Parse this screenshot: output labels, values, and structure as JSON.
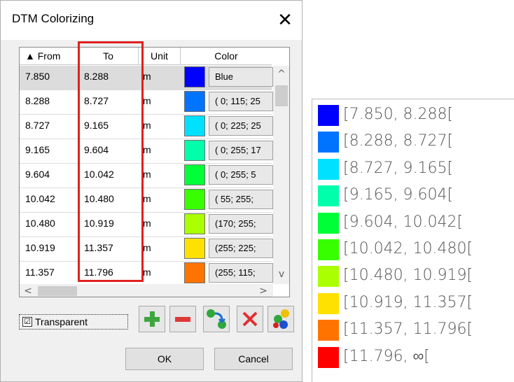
{
  "dialog": {
    "title": "DTM Colorizing",
    "close_glyph": "✕",
    "columns": {
      "from": "▲ From",
      "to": "To",
      "unit": "Unit",
      "color": "Color"
    },
    "rows": [
      {
        "from": "7.850",
        "to": "8.288",
        "unit": "m",
        "color": "#0000ff",
        "color_label": "Blue"
      },
      {
        "from": "8.288",
        "to": "8.727",
        "unit": "m",
        "color": "#0073ff",
        "color_label": "( 0; 115; 25"
      },
      {
        "from": "8.727",
        "to": "9.165",
        "unit": "m",
        "color": "#00e1ff",
        "color_label": "( 0; 225; 25"
      },
      {
        "from": "9.165",
        "to": "9.604",
        "unit": "m",
        "color": "#00ffaa",
        "color_label": "( 0; 255; 17"
      },
      {
        "from": "9.604",
        "to": "10.042",
        "unit": "m",
        "color": "#00ff37",
        "color_label": "( 0; 255;  5"
      },
      {
        "from": "10.042",
        "to": "10.480",
        "unit": "m",
        "color": "#37ff00",
        "color_label": "( 55; 255;"
      },
      {
        "from": "10.480",
        "to": "10.919",
        "unit": "m",
        "color": "#aaff00",
        "color_label": "(170; 255;"
      },
      {
        "from": "10.919",
        "to": "11.357",
        "unit": "m",
        "color": "#ffe100",
        "color_label": "(255; 225;"
      },
      {
        "from": "11.357",
        "to": "11.796",
        "unit": "m",
        "color": "#ff7300",
        "color_label": "(255; 115;"
      }
    ],
    "transparent_label": "Transparent",
    "transparent_checked": "☑",
    "ok_label": "OK",
    "cancel_label": "Cancel"
  },
  "legend": {
    "items": [
      {
        "color": "#0000ff",
        "label": "[7.850, 8.288["
      },
      {
        "color": "#0073ff",
        "label": "[8.288, 8.727["
      },
      {
        "color": "#00e1ff",
        "label": "[8.727, 9.165["
      },
      {
        "color": "#00ffaa",
        "label": "[9.165, 9.604["
      },
      {
        "color": "#00ff37",
        "label": "[9.604, 10.042["
      },
      {
        "color": "#37ff00",
        "label": "[10.042, 10.480["
      },
      {
        "color": "#aaff00",
        "label": "[10.480, 10.919["
      },
      {
        "color": "#ffe100",
        "label": "[10.919, 11.357["
      },
      {
        "color": "#ff7300",
        "label": "[11.357, 11.796["
      },
      {
        "color": "#ff0000",
        "label": "[11.796, ∞["
      }
    ]
  }
}
